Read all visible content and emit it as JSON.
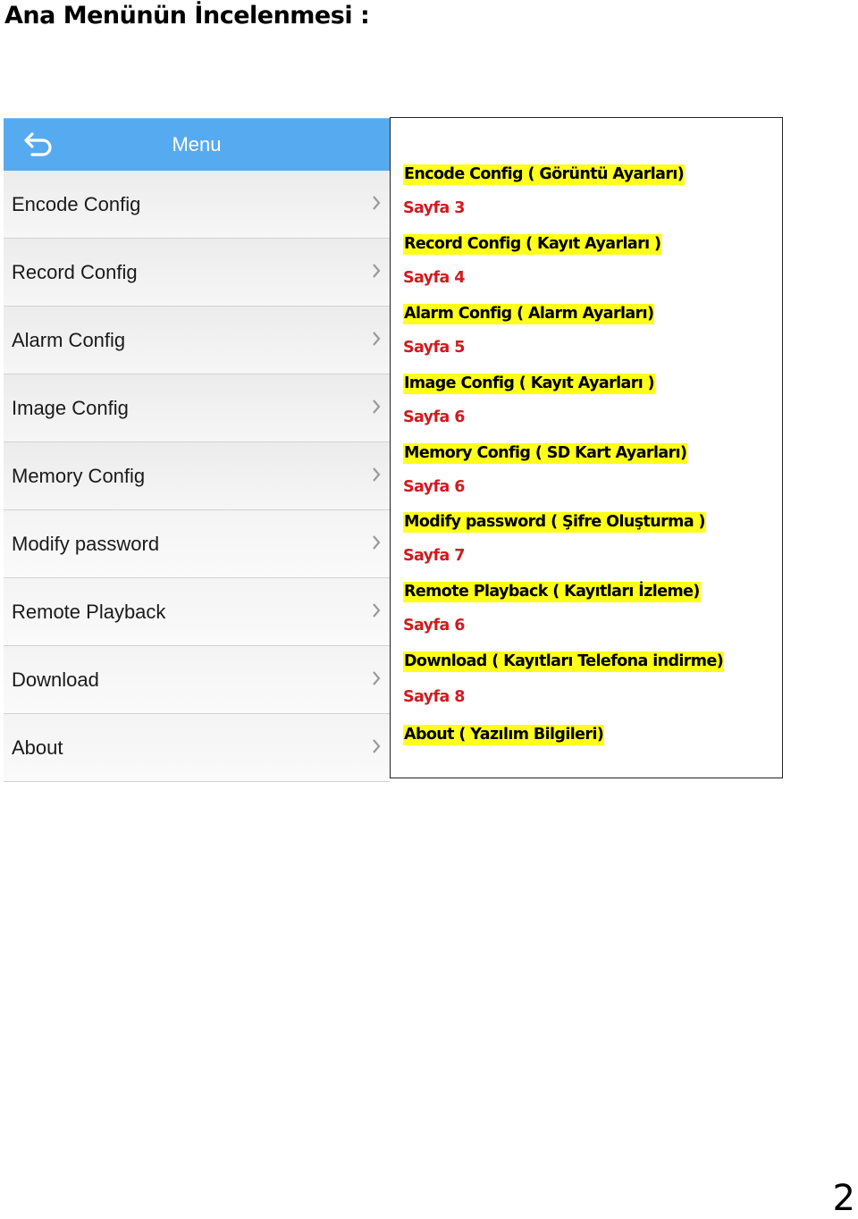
{
  "document": {
    "title": "Ana Menünün İncelenmesi :",
    "page_number": "2"
  },
  "app": {
    "header": {
      "title": "Menu",
      "back_icon": "back-arrow-icon"
    },
    "menu_items": [
      {
        "label": "Encode Config",
        "icon": "chevron-right-icon"
      },
      {
        "label": "Record Config",
        "icon": "chevron-right-icon"
      },
      {
        "label": "Alarm Config",
        "icon": "chevron-right-icon"
      },
      {
        "label": "Image Config",
        "icon": "chevron-right-icon"
      },
      {
        "label": "Memory Config",
        "icon": "chevron-right-icon"
      },
      {
        "label": "Modify password",
        "icon": "chevron-right-icon"
      },
      {
        "label": "Remote Playback",
        "icon": "chevron-right-icon"
      },
      {
        "label": "Download",
        "icon": "chevron-right-icon"
      },
      {
        "label": "About",
        "icon": "chevron-right-icon"
      }
    ]
  },
  "notes": [
    {
      "text": "Encode Config ( Görüntü Ayarları)",
      "type": "highlight"
    },
    {
      "text": "Sayfa 3",
      "type": "page"
    },
    {
      "text": "Record Config ( Kayıt Ayarları )",
      "type": "highlight"
    },
    {
      "text": "Sayfa 4",
      "type": "page"
    },
    {
      "text": "Alarm Config ( Alarm Ayarları)",
      "type": "highlight"
    },
    {
      "text": "Sayfa 5",
      "type": "page"
    },
    {
      "text": "Image Config ( Kayıt Ayarları )",
      "type": "highlight"
    },
    {
      "text": "Sayfa 6",
      "type": "page"
    },
    {
      "text": "Memory Config ( SD Kart Ayarları)",
      "type": "highlight"
    },
    {
      "text": "Sayfa 6",
      "type": "page"
    },
    {
      "text": "Modify password ( Şifre Oluşturma )",
      "type": "highlight"
    },
    {
      "text": "Sayfa 7",
      "type": "page"
    },
    {
      "text": "Remote Playback ( Kayıtları İzleme)",
      "type": "highlight"
    },
    {
      "text": "Sayfa 6",
      "type": "page"
    },
    {
      "text": "Download ( Kayıtları Telefona indirme)",
      "type": "highlight"
    },
    {
      "text": "Sayfa 8",
      "type": "page"
    },
    {
      "text": "About ( Yazılım Bilgileri)",
      "type": "highlight"
    }
  ],
  "colors": {
    "header_blue": "#56aaf0",
    "highlight_yellow": "#ffff1a",
    "page_red": "#d11a20"
  }
}
